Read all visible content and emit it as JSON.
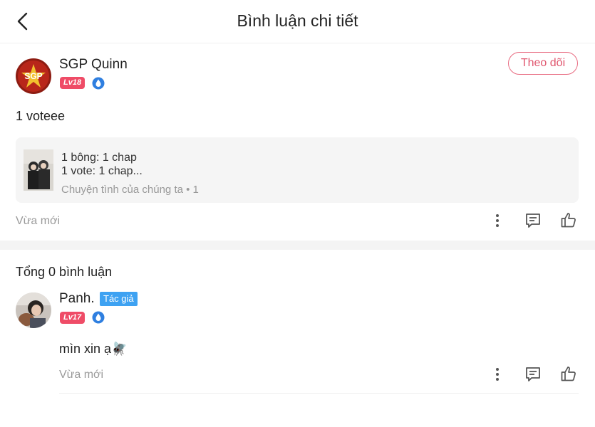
{
  "header": {
    "title": "Bình luận chi tiết",
    "back_icon": "chevron-left-icon"
  },
  "post": {
    "author": {
      "name": "SGP Quinn",
      "level": "Lv18",
      "avatar_text": "SGP"
    },
    "follow_label": "Theo dõi",
    "text": "1 voteee",
    "book": {
      "line1": "1 bông: 1 chap",
      "line2": "1 vote: 1 chap...",
      "meta": "Chuyện tình của chúng ta • 1"
    },
    "time": "Vừa mới"
  },
  "comments": {
    "count_label": "Tổng 0 bình luận",
    "items": [
      {
        "author": "Panh.",
        "tag": "Tác giả",
        "level": "Lv17",
        "text": "mìn xin ạ🪰",
        "time": "Vừa mới"
      }
    ]
  },
  "icons": [
    "more-vertical-icon",
    "comment-icon",
    "like-icon",
    "vip-drop-icon"
  ],
  "colors": {
    "level_badge": "#ef4c67",
    "follow": "#e0566e",
    "author_tag": "#3ea2f2",
    "vip": "#2f7fe0"
  }
}
